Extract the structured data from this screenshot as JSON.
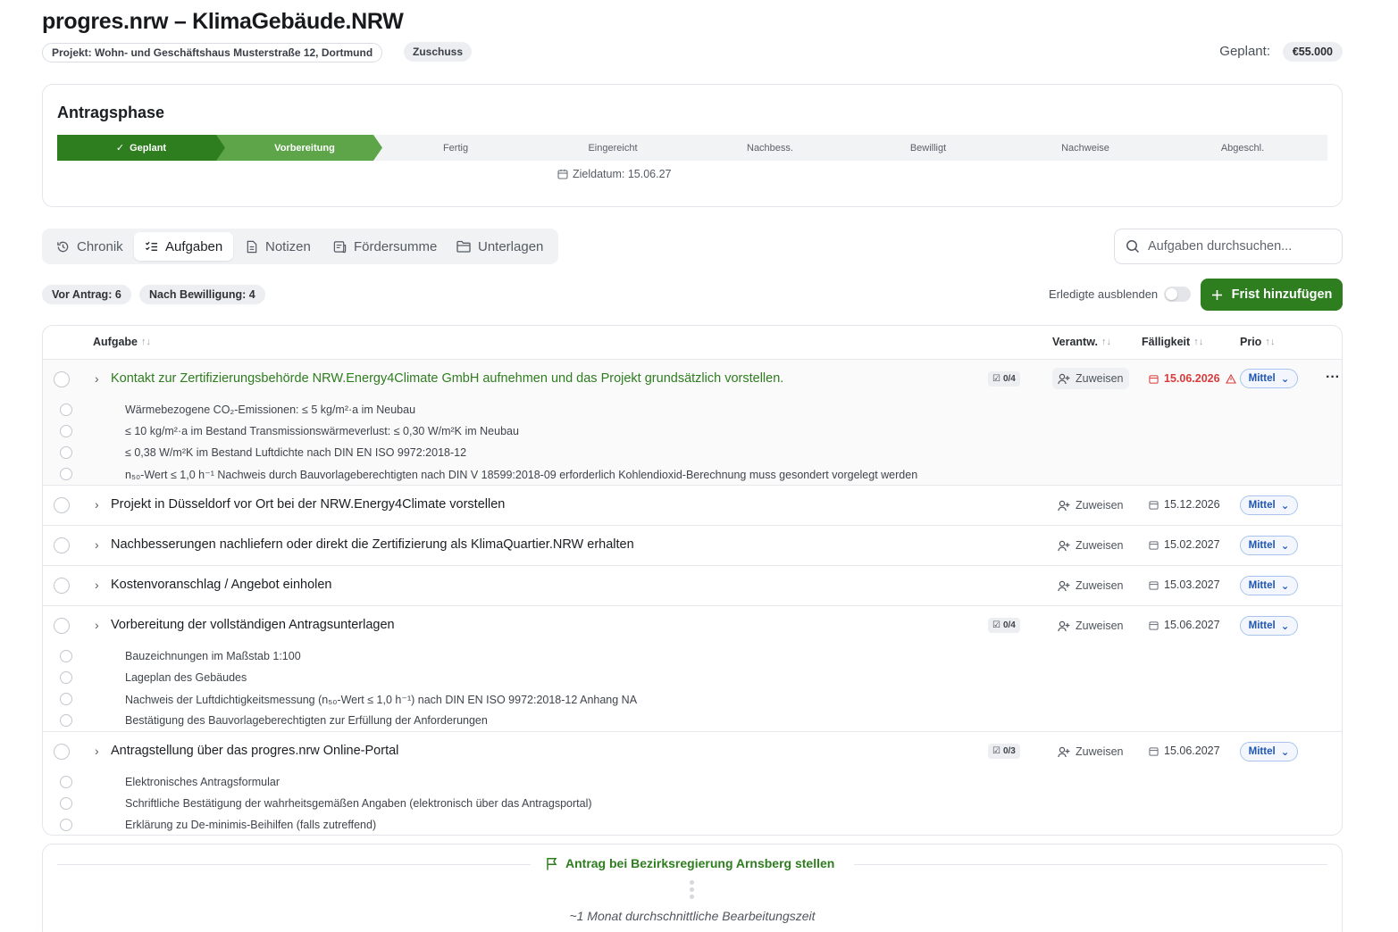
{
  "header": {
    "title": "progres.nrw – KlimaGebäude.NRW",
    "project": "Projekt: Wohn- und Geschäftshaus Musterstraße 12, Dortmund",
    "type_badge": "Zuschuss",
    "planned_label": "Geplant:",
    "planned_amount": "€55.000"
  },
  "phase": {
    "title": "Antragsphase",
    "steps": [
      {
        "label": "Geplant",
        "state": "done"
      },
      {
        "label": "Vorbereitung",
        "state": "current"
      },
      {
        "label": "Fertig",
        "state": "todo"
      },
      {
        "label": "Eingereicht",
        "state": "todo"
      },
      {
        "label": "Nachbess.",
        "state": "todo"
      },
      {
        "label": "Bewilligt",
        "state": "todo"
      },
      {
        "label": "Nachweise",
        "state": "todo"
      },
      {
        "label": "Abgeschl.",
        "state": "todo"
      }
    ],
    "target_date": "Zieldatum: 15.06.27"
  },
  "tabs": [
    {
      "label": "Chronik",
      "icon": "history-icon"
    },
    {
      "label": "Aufgaben",
      "icon": "checklist-icon",
      "active": true
    },
    {
      "label": "Notizen",
      "icon": "document-icon"
    },
    {
      "label": "Fördersumme",
      "icon": "receipt-icon"
    },
    {
      "label": "Unterlagen",
      "icon": "folder-icon"
    }
  ],
  "search": {
    "placeholder": "Aufgaben durchsuchen..."
  },
  "filters": {
    "before": "Vor Antrag: 6",
    "after": "Nach Bewilligung: 4",
    "hide_done": "Erledigte ausblenden",
    "add_button": "Frist hinzufügen"
  },
  "table": {
    "columns": {
      "task": "Aufgabe",
      "owner": "Verantw.",
      "due": "Fälligkeit",
      "prio": "Prio"
    },
    "assign_label": "Zuweisen",
    "prio_label": "Mittel",
    "tasks": [
      {
        "title": "Kontakt zur Zertifizierungsbehörde NRW.Energy4Climate GmbH aufnehmen und das Projekt grundsätzlich vorstellen.",
        "badge": "0/4",
        "due": "15.06.2026",
        "overdue": true,
        "subtasks": [
          "Wärmebezogene CO₂-Emissionen: ≤ 5 kg/m²·a im Neubau",
          "≤ 10 kg/m²·a im Bestand Transmissionswärmeverlust: ≤ 0,30 W/m²K im Neubau",
          "≤ 0,38 W/m²K im Bestand Luftdichte nach DIN EN ISO 9972:2018-12",
          "n₅₀-Wert ≤ 1,0 h⁻¹ Nachweis durch Bauvorlageberechtigten nach DIN V 18599:2018-09 erforderlich Kohlendioxid-Berechnung muss gesondert vorgelegt werden"
        ]
      },
      {
        "title": "Projekt in Düsseldorf vor Ort bei der NRW.Energy4Climate vorstellen",
        "due": "15.12.2026"
      },
      {
        "title": "Nachbesserungen nachliefern oder direkt die Zertifizierung als KlimaQuartier.NRW erhalten",
        "due": "15.02.2027"
      },
      {
        "title": "Kostenvoranschlag / Angebot einholen",
        "due": "15.03.2027"
      },
      {
        "title": "Vorbereitung der vollständigen Antragsunterlagen",
        "badge": "0/4",
        "due": "15.06.2027",
        "subtasks": [
          "Bauzeichnungen im Maßstab 1:100",
          "Lageplan des Gebäudes",
          "Nachweis der Luftdichtigkeitsmessung (n₅₀-Wert ≤ 1,0 h⁻¹) nach DIN EN ISO 9972:2018-12 Anhang NA",
          "Bestätigung des Bauvorlageberechtigten zur Erfüllung der Anforderungen"
        ]
      },
      {
        "title": "Antragstellung über das progres.nrw Online-Portal",
        "badge": "0/3",
        "due": "15.06.2027",
        "subtasks": [
          "Elektronisches Antragsformular",
          "Schriftliche Bestätigung der wahrheitsgemäßen Angaben (elektronisch über das Antragsportal)",
          "Erklärung zu De-minimis-Beihilfen (falls zutreffend)"
        ]
      }
    ]
  },
  "milestone": {
    "title": "Antrag bei Bezirksregierung Arnsberg stellen",
    "note": "~1 Monat durchschnittliche Bearbeitungszeit"
  },
  "colors": {
    "accent": "#2e7d1f",
    "accent_light": "#5da548",
    "danger": "#d93b3b",
    "prio": "#1f55b5"
  }
}
